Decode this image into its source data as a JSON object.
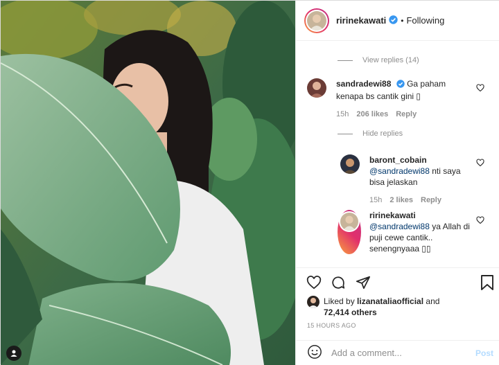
{
  "post": {
    "owner_username": "ririnekawati",
    "follow_status": "Following",
    "separator": "•"
  },
  "comments": {
    "view_replies_label": "View replies (14)",
    "hide_replies_label": "Hide replies",
    "items": [
      {
        "username": "sandradewi88",
        "verified": true,
        "text": "Ga paham kenapa bs cantik gini ",
        "emoji": "▯",
        "time": "15h",
        "likes": "206 likes",
        "reply_label": "Reply"
      },
      {
        "username": "baront_cobain",
        "mention": "@sandradewi88",
        "text": " nti saya bisa jelaskan",
        "time": "15h",
        "likes": "2 likes",
        "reply_label": "Reply"
      },
      {
        "username": "ririnekawati",
        "mention": "@sandradewi88",
        "text": " ya Allah di puji cewe cantik.. senengnyaaa ",
        "emoji": "▯▯"
      }
    ]
  },
  "engagement": {
    "liked_by_prefix": "Liked by ",
    "liked_by_user": "lizanataliaofficial",
    "liked_by_and": " and",
    "others_count": "72,414 others",
    "timestamp": "15 HOURS AGO"
  },
  "composer": {
    "placeholder": "Add a comment...",
    "post_label": "Post"
  },
  "colors": {
    "verified_blue": "#3897f0",
    "link_blue": "#00376b",
    "post_button_disabled": "#b3dbff",
    "story_ring_start": "#f9a23c",
    "story_ring_end": "#c13584"
  },
  "icons": {
    "photo_user_tags": "user-tag-icon",
    "like": "heart-icon",
    "comment": "speech-bubble-icon",
    "share": "paper-plane-icon",
    "save": "bookmark-icon",
    "emoji": "smiley-icon"
  }
}
